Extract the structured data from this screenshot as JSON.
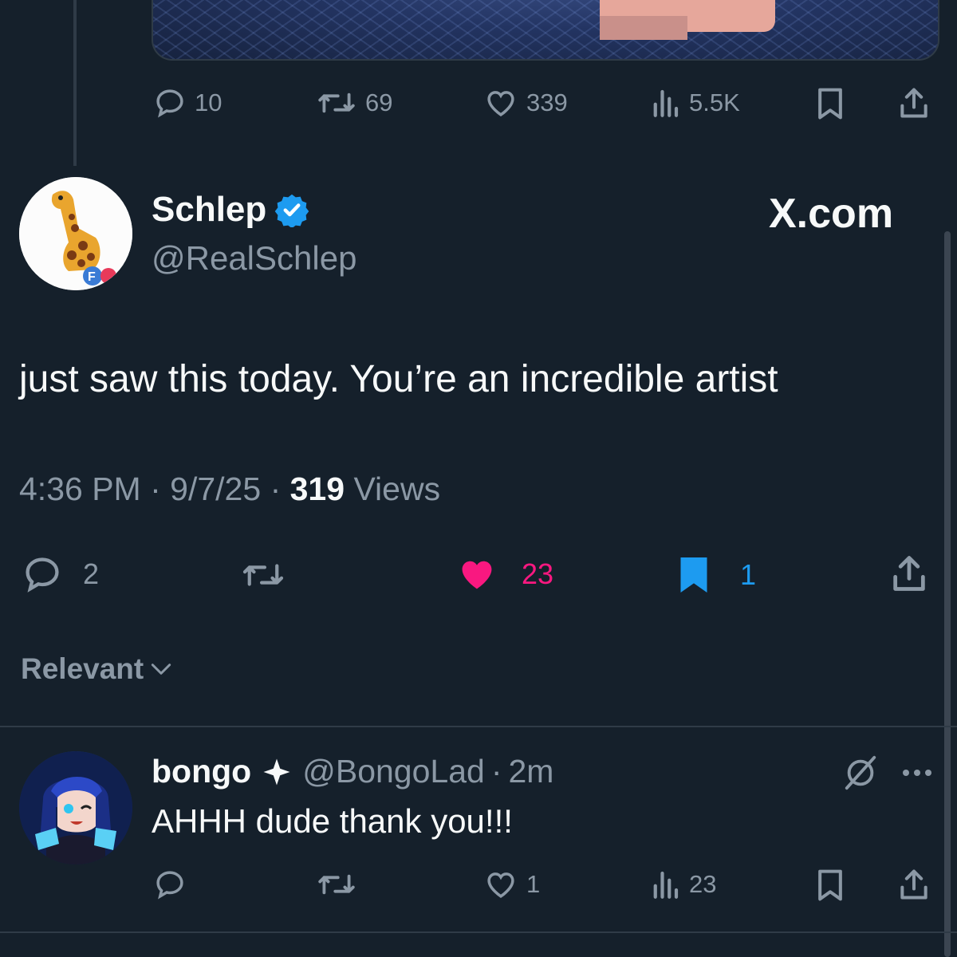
{
  "parent_tweet": {
    "actions": {
      "replies": "10",
      "reposts": "69",
      "likes": "339",
      "views": "5.5K"
    }
  },
  "main_tweet": {
    "display_name": "Schlep",
    "handle": "@RealSchlep",
    "site_label": "X.com",
    "text": "just saw this today. You’re an incredible artist",
    "time": "4:36 PM",
    "date": "9/7/25",
    "views_count": "319",
    "views_label": "Views",
    "actions": {
      "replies": "2",
      "likes": "23",
      "bookmarks": "1"
    },
    "colors": {
      "like": "#f91880",
      "bookmark": "#1d9bf0",
      "verified": "#1d9bf0"
    }
  },
  "sort": {
    "label": "Relevant"
  },
  "reply": {
    "display_name": "bongo",
    "handle": "@BongoLad",
    "time": "2m",
    "text": "AHHH dude thank you!!!",
    "actions": {
      "likes": "1",
      "views": "23"
    }
  },
  "icons": [
    "reply-icon",
    "repost-icon",
    "like-icon",
    "views-icon",
    "bookmark-icon",
    "share-icon",
    "verified-badge-icon",
    "chevron-down-icon",
    "grok-icon",
    "more-icon"
  ]
}
